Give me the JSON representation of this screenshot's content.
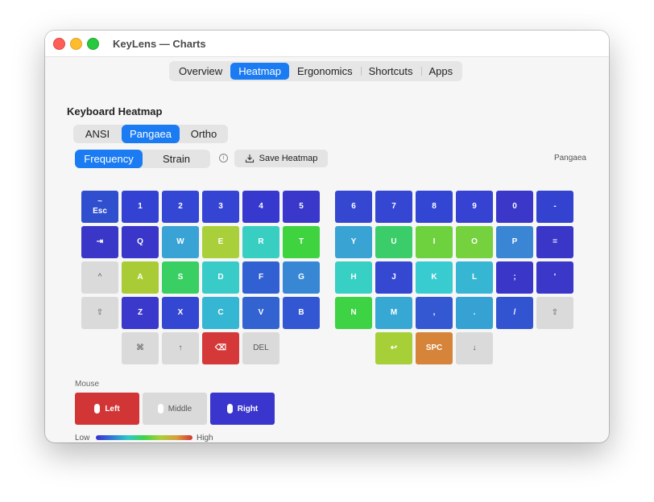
{
  "window": {
    "title": "KeyLens — Charts"
  },
  "tabs": [
    "Overview",
    "Heatmap",
    "Ergonomics",
    "Shortcuts",
    "Apps"
  ],
  "active_tab": "Heatmap",
  "section_title": "Keyboard Heatmap",
  "layouts": {
    "options": [
      "ANSI",
      "Pangaea",
      "Ortho"
    ],
    "selected": "Pangaea"
  },
  "modes": {
    "options": [
      "Frequency",
      "Strain"
    ],
    "selected": "Frequency"
  },
  "info_icon": "info-circle-icon",
  "save_button": {
    "label": "Save Heatmap",
    "icon": "download-tray-icon"
  },
  "layout_caption": "Pangaea",
  "keyboard": {
    "left": [
      [
        {
          "label": "~\nEsc",
          "color": "#2f4fcf"
        },
        {
          "label": "1",
          "color": "#3442d3"
        },
        {
          "label": "2",
          "color": "#3446d4"
        },
        {
          "label": "3",
          "color": "#3544d3"
        },
        {
          "label": "4",
          "color": "#3638ce"
        },
        {
          "label": "5",
          "color": "#3a38ca"
        }
      ],
      [
        {
          "label": "⇥",
          "color": "#3a37c8"
        },
        {
          "label": "Q",
          "color": "#3a36c9"
        },
        {
          "label": "W",
          "color": "#3aa3d5"
        },
        {
          "label": "E",
          "color": "#a9d03a"
        },
        {
          "label": "R",
          "color": "#38cfc2"
        },
        {
          "label": "T",
          "color": "#3ed33f"
        }
      ],
      [
        {
          "label": "^",
          "color": "#dadada",
          "light": true
        },
        {
          "label": "A",
          "color": "#a9cc36"
        },
        {
          "label": "S",
          "color": "#3acf62"
        },
        {
          "label": "D",
          "color": "#38cbc8"
        },
        {
          "label": "F",
          "color": "#3060d2"
        },
        {
          "label": "G",
          "color": "#3787d4"
        }
      ],
      [
        {
          "label": "⇧",
          "color": "#dadada",
          "light": true
        },
        {
          "label": "Z",
          "color": "#3a39cc"
        },
        {
          "label": "X",
          "color": "#3447d2"
        },
        {
          "label": "C",
          "color": "#35b6d2"
        },
        {
          "label": "V",
          "color": "#3263d1"
        },
        {
          "label": "B",
          "color": "#3356d3"
        }
      ],
      [
        null,
        {
          "label": "⌘",
          "color": "#dadada",
          "light": true
        },
        {
          "label": "↑",
          "color": "#dadada",
          "light": true
        },
        {
          "label": "⌫",
          "color": "#d53838"
        },
        {
          "label": "DEL",
          "color": "#dadada",
          "light": true
        },
        null
      ]
    ],
    "right": [
      [
        {
          "label": "6",
          "color": "#3546d1"
        },
        {
          "label": "7",
          "color": "#3546d2"
        },
        {
          "label": "8",
          "color": "#3346d3"
        },
        {
          "label": "9",
          "color": "#3642d1"
        },
        {
          "label": "0",
          "color": "#3a37c9"
        },
        {
          "label": "-",
          "color": "#3442d0"
        }
      ],
      [
        {
          "label": "Y",
          "color": "#39a3d4"
        },
        {
          "label": "U",
          "color": "#3acd6a"
        },
        {
          "label": "I",
          "color": "#6ed13e"
        },
        {
          "label": "O",
          "color": "#76d13e"
        },
        {
          "label": "P",
          "color": "#3a86d4"
        },
        {
          "label": "=",
          "color": "#3a37c8"
        }
      ],
      [
        {
          "label": "H",
          "color": "#38cfc4"
        },
        {
          "label": "J",
          "color": "#3448d2"
        },
        {
          "label": "K",
          "color": "#38ccd0"
        },
        {
          "label": "L",
          "color": "#36b6d3"
        },
        {
          "label": ";",
          "color": "#3a36c8"
        },
        {
          "label": "'",
          "color": "#3a37c9"
        }
      ],
      [
        {
          "label": "N",
          "color": "#3ed344"
        },
        {
          "label": "M",
          "color": "#36a8d3"
        },
        {
          "label": ",",
          "color": "#3458d1"
        },
        {
          "label": ".",
          "color": "#35a2d3"
        },
        {
          "label": "/",
          "color": "#3354d1"
        },
        {
          "label": "⇧",
          "color": "#dadada",
          "light": true
        }
      ],
      [
        null,
        {
          "label": "↩",
          "color": "#a7cf38"
        },
        {
          "label": "SPC",
          "color": "#d6843a"
        },
        {
          "label": "↓",
          "color": "#dadada",
          "light": true
        },
        null,
        null
      ]
    ]
  },
  "mouse": {
    "label": "Mouse",
    "buttons": [
      {
        "label": "Left",
        "color": "#d23535",
        "light": false
      },
      {
        "label": "Middle",
        "color": "#dadada",
        "light": true
      },
      {
        "label": "Right",
        "color": "#3a35cc",
        "light": false
      }
    ]
  },
  "legend": {
    "low": "Low",
    "high": "High"
  }
}
